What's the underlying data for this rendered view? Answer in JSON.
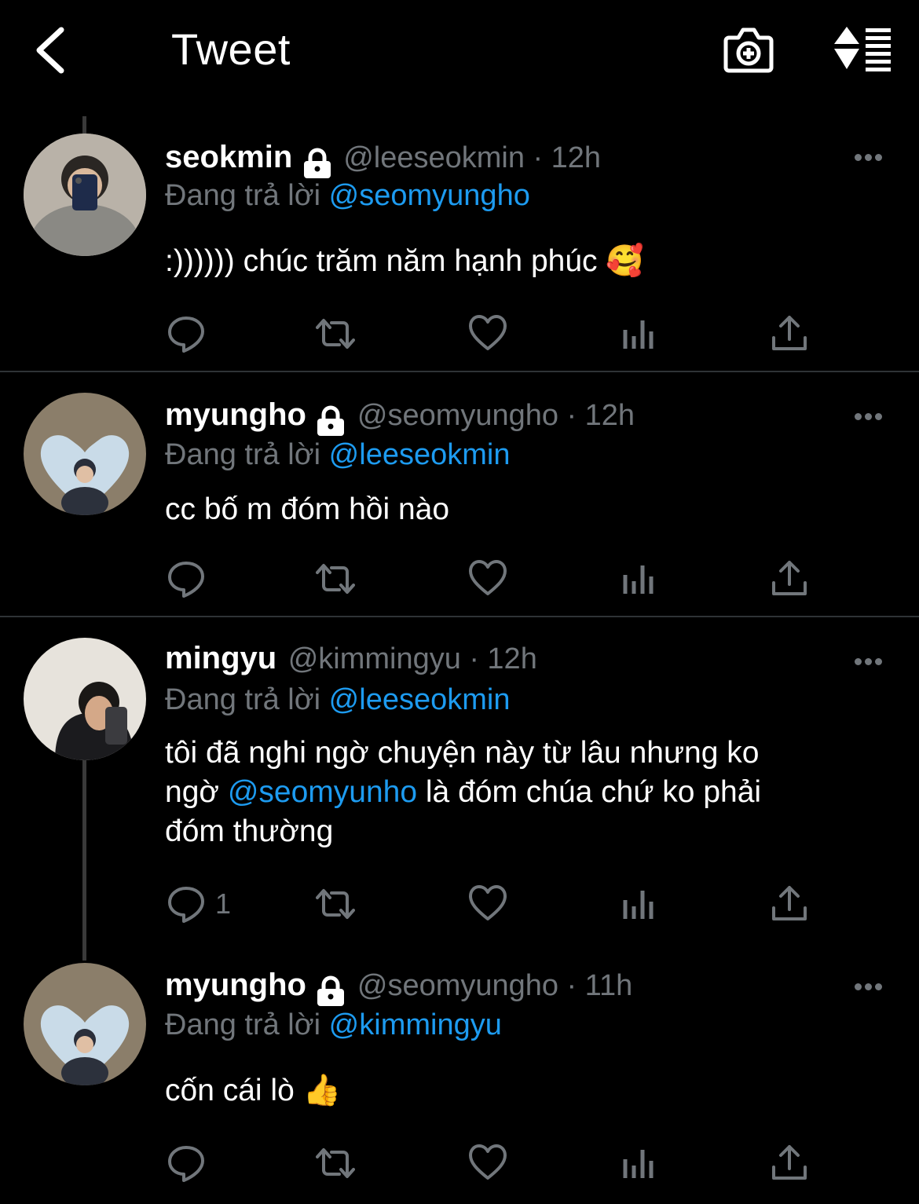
{
  "header": {
    "title": "Tweet"
  },
  "tweets": [
    {
      "name": "seokmin",
      "handle": "@leeseokmin",
      "sep": "·",
      "time": "12h",
      "reply_prefix": "Đang trả lời",
      "reply_to": "@seomyungho",
      "text": ":)))))) chúc trăm năm hạnh phúc",
      "emoji": "🥰",
      "locked": true
    },
    {
      "name": "myungho",
      "handle": "@seomyungho",
      "sep": "·",
      "time": "12h",
      "reply_prefix": "Đang trả lời",
      "reply_to": "@leeseokmin",
      "text": "cc bố m đóm hồi nào",
      "locked": true
    },
    {
      "name": "mingyu",
      "handle": "@kimmingyu",
      "sep": "·",
      "time": "12h",
      "reply_prefix": "Đang trả lời",
      "reply_to": "@leeseokmin",
      "text_line1": "tôi đã nghi ngờ chuyện này từ lâu nhưng ko",
      "text_line2_pre": "ngờ",
      "text_line2_mention": "@seomyunho",
      "text_line2_post": "là đóm chúa chứ ko phải",
      "text_line3": "đóm thường",
      "reply_count": "1",
      "locked": false
    },
    {
      "name": "myungho",
      "handle": "@seomyungho",
      "sep": "·",
      "time": "11h",
      "reply_prefix": "Đang trả lời",
      "reply_to": "@kimmingyu",
      "text": "cốn cái lò",
      "emoji": "👍",
      "locked": true
    }
  ],
  "colors": {
    "background": "#000000",
    "secondary_text": "#71767b",
    "accent": "#1d9bf0",
    "divider": "#2f3336"
  }
}
